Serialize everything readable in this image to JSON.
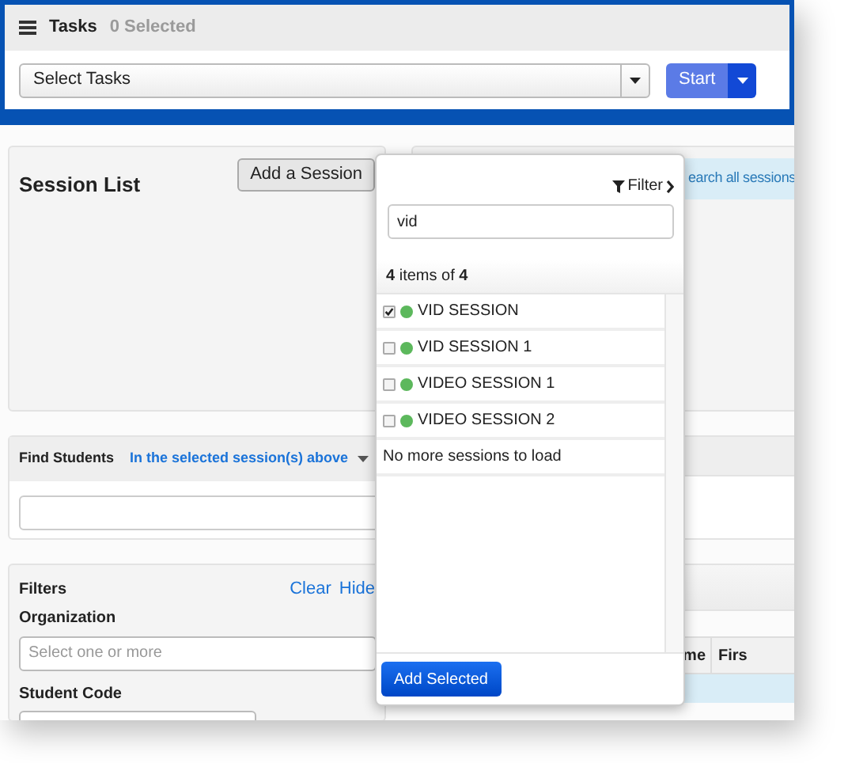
{
  "header": {
    "title": "Tasks",
    "selected_count": "0 Selected",
    "task_select": {
      "placeholder": "Select Tasks"
    },
    "start_button": "Start"
  },
  "session_list": {
    "title": "Session List",
    "add_button": "Add a Session"
  },
  "find_students": {
    "title": "Find Students",
    "scope": "In the selected session(s) above"
  },
  "filters": {
    "title": "Filters",
    "clear": "Clear",
    "hide": "Hide",
    "organization": {
      "label": "Organization",
      "placeholder": "Select one or more"
    },
    "student_code": {
      "label": "Student Code"
    }
  },
  "right_panel": {
    "info_link": "earch all sessions",
    "table": {
      "columns": [
        "me",
        "Firs"
      ]
    }
  },
  "session_popup": {
    "filter_label": "Filter",
    "search": {
      "value": "vid"
    },
    "count": "**4** items of **4**",
    "sessions": [
      {
        "name": "VID SESSION",
        "checked": true
      },
      {
        "name": "VID SESSION 1",
        "checked": false
      },
      {
        "name": "VIDEO SESSION 1",
        "checked": false
      },
      {
        "name": "VIDEO SESSION 2",
        "checked": false
      }
    ],
    "end_message": "No more sessions to load",
    "add_button": "Add Selected"
  }
}
